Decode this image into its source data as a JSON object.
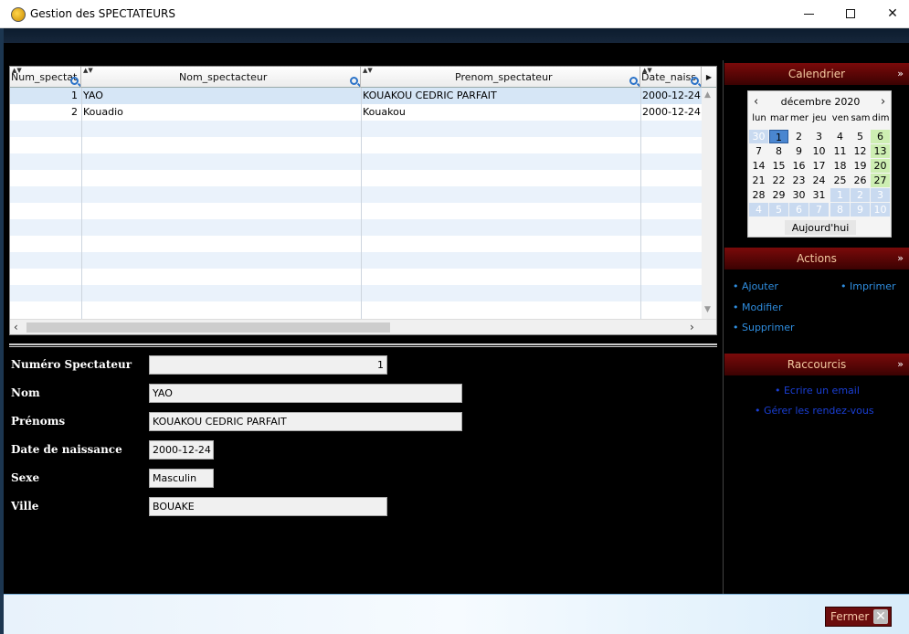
{
  "window": {
    "title": "Gestion des SPECTATEURS"
  },
  "table": {
    "columns": [
      "Num_spectat",
      "Nom_spectacteur",
      "Prenom_spectateur",
      "Date_naiss"
    ],
    "rows": [
      {
        "num": "1",
        "nom": "YAO",
        "prenom": "KOUAKOU CEDRIC PARFAIT",
        "date": "2000-12-24"
      },
      {
        "num": "2",
        "nom": "Kouadio",
        "prenom": "Kouakou",
        "date": "2000-12-24"
      }
    ]
  },
  "form": {
    "numero_label": "Numéro Spectateur",
    "numero_value": "1",
    "nom_label": "Nom",
    "nom_value": "YAO",
    "prenoms_label": "Prénoms",
    "prenoms_value": "KOUAKOU CEDRIC PARFAIT",
    "date_label": "Date de naissance",
    "date_value": "2000-12-24",
    "sexe_label": "Sexe",
    "sexe_value": "Masculin",
    "ville_label": "Ville",
    "ville_value": "BOUAKE"
  },
  "calendar": {
    "title": "Calendrier",
    "month": "décembre 2020",
    "weekdays": [
      "lun",
      "mar",
      "mer",
      "jeu",
      "ven",
      "sam",
      "dim"
    ],
    "weeks": [
      [
        "30",
        "1",
        "2",
        "3",
        "4",
        "5",
        "6"
      ],
      [
        "7",
        "8",
        "9",
        "10",
        "11",
        "12",
        "13"
      ],
      [
        "14",
        "15",
        "16",
        "17",
        "18",
        "19",
        "20"
      ],
      [
        "21",
        "22",
        "23",
        "24",
        "25",
        "26",
        "27"
      ],
      [
        "28",
        "29",
        "30",
        "31",
        "1",
        "2",
        "3"
      ],
      [
        "4",
        "5",
        "6",
        "7",
        "8",
        "9",
        "10"
      ]
    ],
    "today_label": "Aujourd'hui"
  },
  "actions": {
    "title": "Actions",
    "ajouter": "• Ajouter",
    "modifier": "• Modifier",
    "supprimer": "• Supprimer",
    "imprimer": "• Imprimer"
  },
  "shortcuts": {
    "title": "Raccourcis",
    "email": "• Ecrire un email",
    "rdv": "• Gérer les rendez-vous"
  },
  "footer": {
    "close_label": "Fermer"
  },
  "colors": {
    "panel_header": "#5a0606",
    "link": "#2f8ee0",
    "weekend": "#cdeeb2",
    "selected_day": "#4a86d0"
  }
}
